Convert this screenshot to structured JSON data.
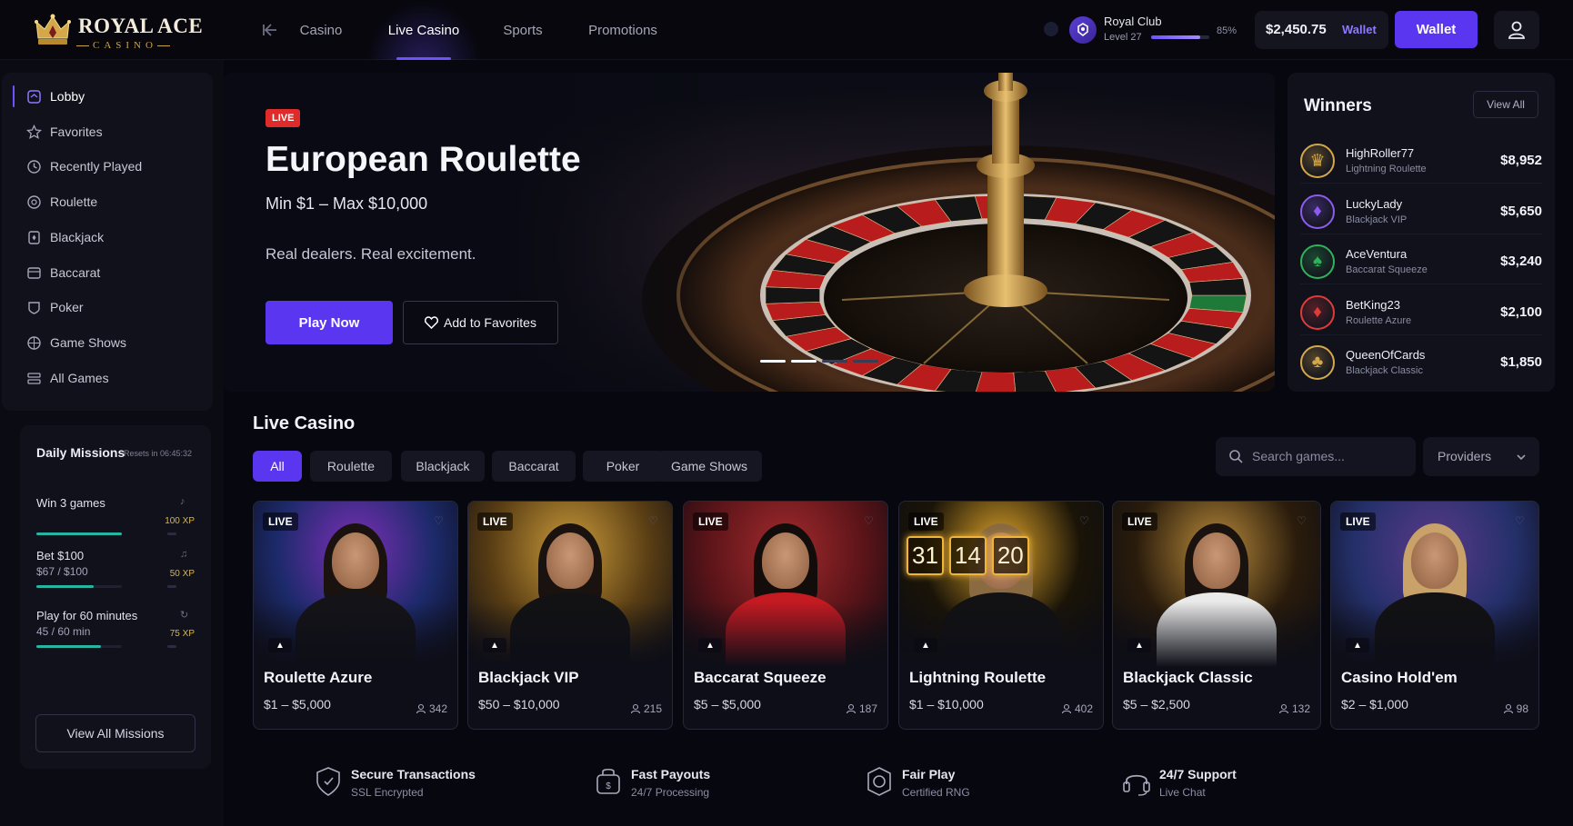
{
  "brand": {
    "name": "ROYAL ACE",
    "sub": "CASINO"
  },
  "nav": {
    "tabs": [
      "Casino",
      "Live Casino",
      "Sports",
      "Promotions"
    ],
    "active": "Live Casino"
  },
  "club": {
    "name": "Royal Club",
    "level": "Level 27",
    "progress": 0.85,
    "pct_label": "85%"
  },
  "balance": {
    "amount": "$2,450.75",
    "currency": "Wallet"
  },
  "wallet_button": "Wallet",
  "sidebar": {
    "items": [
      {
        "label": "Lobby",
        "icon": "lobby-icon",
        "active": true
      },
      {
        "label": "Favorites",
        "icon": "star-icon"
      },
      {
        "label": "Recently Played",
        "icon": "clock-icon"
      },
      {
        "label": "Roulette",
        "icon": "roulette-icon"
      },
      {
        "label": "Blackjack",
        "icon": "blackjack-icon"
      },
      {
        "label": "Baccarat",
        "icon": "baccarat-icon"
      },
      {
        "label": "Poker",
        "icon": "poker-icon"
      },
      {
        "label": "Game Shows",
        "icon": "gameshow-icon"
      },
      {
        "label": "All Games",
        "icon": "grid-icon"
      }
    ]
  },
  "missions": {
    "title": "Daily Missions",
    "reset": "Resets in 06:45:32",
    "items": [
      {
        "name": "Win 3 games",
        "progress_text": "",
        "xp": "100 XP",
        "progress": 1.0
      },
      {
        "name": "Bet $100",
        "progress_text": "$67 / $100",
        "xp": "50 XP",
        "progress": 0.67
      },
      {
        "name": "Play for 60 minutes",
        "progress_text": "45 / 60 min",
        "xp": "75 XP",
        "progress": 0.75
      }
    ],
    "button": "View All Missions"
  },
  "hero": {
    "badge": "LIVE",
    "title": "European Roulette",
    "range": "Min $1 – Max $10,000",
    "tagline": "Real dealers. Real excitement.",
    "play_label": "Play Now",
    "fav_label": "Add to Favorites",
    "slide_count": 4,
    "active_slide": 1
  },
  "winners": {
    "title": "Winners",
    "view_all": "View All",
    "items": [
      {
        "name": "HighRoller77",
        "game": "Lightning Roulette",
        "amount": "$8,952",
        "icon": "crown-icon",
        "color": "#d4a84a"
      },
      {
        "name": "LuckyLady",
        "game": "Blackjack VIP",
        "amount": "$5,650",
        "icon": "diamond-icon",
        "color": "#8c5cf0"
      },
      {
        "name": "AceVentura",
        "game": "Baccarat Squeeze",
        "amount": "$3,240",
        "icon": "spade-icon",
        "color": "#2fb35a"
      },
      {
        "name": "BetKing23",
        "game": "Roulette Azure",
        "amount": "$2,100",
        "icon": "diamond-red-icon",
        "color": "#e03a3a"
      },
      {
        "name": "QueenOfCards",
        "game": "Blackjack Classic",
        "amount": "$1,850",
        "icon": "club-icon",
        "color": "#d4a84a"
      }
    ]
  },
  "live_casino": {
    "title": "Live Casino",
    "filters": [
      "All",
      "Roulette",
      "Blackjack",
      "Baccarat",
      "Poker",
      "Game Shows"
    ],
    "active_filter": "All",
    "search_placeholder": "Search games...",
    "providers_label": "Providers",
    "games": [
      {
        "title": "Roulette Azure",
        "range": "$1 – $5,000",
        "players": "342",
        "bg": "#1c2a6a",
        "accent": "#7d2fb8",
        "outfit": "#141418",
        "hair": "#1a120e"
      },
      {
        "title": "Blackjack VIP",
        "range": "$50 – $10,000",
        "players": "215",
        "bg": "#5a3e14",
        "accent": "#c99a3a",
        "outfit": "#121214",
        "hair": "#1a120e"
      },
      {
        "title": "Baccarat Squeeze",
        "range": "$5 – $5,000",
        "players": "187",
        "bg": "#5a1418",
        "accent": "#a32a2e",
        "outfit": "#c41a22",
        "hair": "#120c0a"
      },
      {
        "title": "Lightning Roulette",
        "range": "$1 – $10,000",
        "players": "402",
        "bg": "#1a1408",
        "accent": "#e0a52a",
        "outfit": "#121214",
        "hair": "#8a6a40"
      },
      {
        "title": "Blackjack Classic",
        "range": "$5 – $2,500",
        "players": "132",
        "bg": "#2a1c0c",
        "accent": "#b88a3a",
        "outfit": "#eaeaea",
        "hair": "#1a120e"
      },
      {
        "title": "Casino Hold'em",
        "range": "$2 – $1,000",
        "players": "98",
        "bg": "#24306a",
        "accent": "#5a3a8a",
        "outfit": "#121214",
        "hair": "#c9a26a"
      }
    ],
    "lightning_numbers": [
      "31",
      "14",
      "20"
    ]
  },
  "features": [
    {
      "title": "Secure Transactions",
      "sub": "SSL Encrypted",
      "icon": "shield-icon"
    },
    {
      "title": "Fast Payouts",
      "sub": "24/7 Processing",
      "icon": "payout-icon"
    },
    {
      "title": "Fair Play",
      "sub": "Certified RNG",
      "icon": "fairplay-icon"
    },
    {
      "title": "24/7 Support",
      "sub": "Live Chat",
      "icon": "headset-icon"
    }
  ],
  "colors": {
    "accent": "#5a36f0",
    "live": "#e02b2b",
    "mission_bar": "#26b5a3",
    "xp": "#d8b44e"
  }
}
